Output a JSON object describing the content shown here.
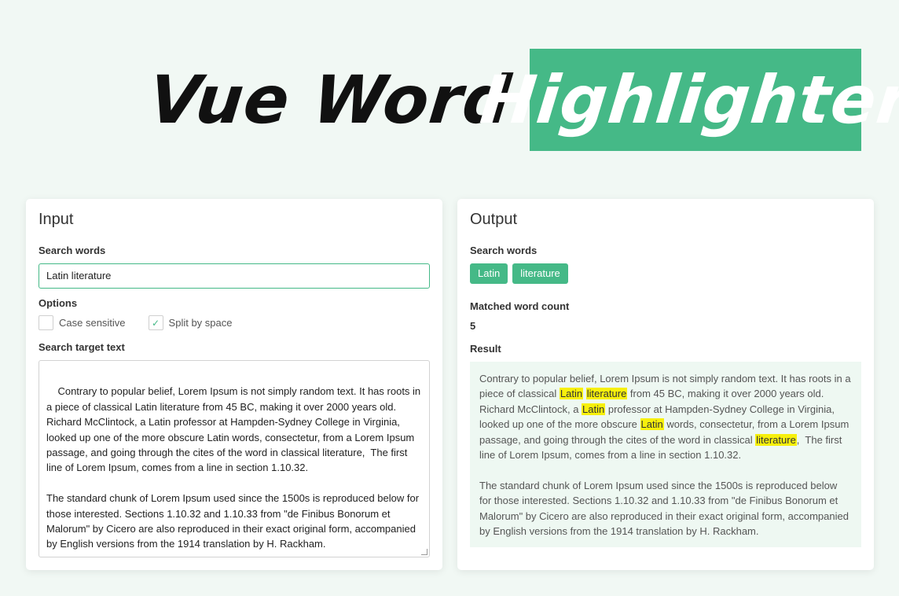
{
  "header": {
    "title_plain": "Vue Word",
    "title_highlight": "Highlighter"
  },
  "colors": {
    "accent": "#45b987",
    "highlight": "#f7f00c",
    "background": "#f1f8f4"
  },
  "input": {
    "title": "Input",
    "search_words_label": "Search words",
    "search_words_value": "Latin literature",
    "options_label": "Options",
    "options": [
      {
        "label": "Case sensitive",
        "checked": false
      },
      {
        "label": "Split by space",
        "checked": true
      }
    ],
    "target_text_label": "Search target text",
    "target_text": "Contrary to popular belief, Lorem Ipsum is not simply random text. It has roots in a piece of classical Latin literature from 45 BC, making it over 2000 years old. Richard McClintock, a Latin professor at Hampden-Sydney College in Virginia, looked up one of the more obscure Latin words, consectetur, from a Lorem Ipsum passage, and going through the cites of the word in classical literature,  The first line of Lorem Ipsum, comes from a line in section 1.10.32.\n\nThe standard chunk of Lorem Ipsum used since the 1500s is reproduced below for those interested. Sections 1.10.32 and 1.10.33 from \"de Finibus Bonorum et Malorum\" by Cicero are also reproduced in their exact original form, accompanied by English versions from the 1914 translation by H. Rackham."
  },
  "output": {
    "title": "Output",
    "search_words_label": "Search words",
    "tags": [
      "Latin",
      "literature"
    ],
    "matched_count_label": "Matched word count",
    "matched_count": "5",
    "result_label": "Result",
    "result_segments": [
      {
        "text": "Contrary to popular belief, Lorem Ipsum is not simply random text. It has roots in a piece of classical ",
        "hl": false
      },
      {
        "text": "Latin",
        "hl": true
      },
      {
        "text": " ",
        "hl": false
      },
      {
        "text": "literature",
        "hl": true
      },
      {
        "text": " from 45 BC, making it over 2000 years old. Richard McClintock, a ",
        "hl": false
      },
      {
        "text": "Latin",
        "hl": true
      },
      {
        "text": " professor at Hampden-Sydney College in Virginia, looked up one of the more obscure ",
        "hl": false
      },
      {
        "text": "Latin",
        "hl": true
      },
      {
        "text": " words, consectetur, from a Lorem Ipsum passage, and going through the cites of the word in classical ",
        "hl": false
      },
      {
        "text": "literature",
        "hl": true
      },
      {
        "text": ",  The first line of Lorem Ipsum, comes from a line in section 1.10.32.\n\nThe standard chunk of Lorem Ipsum used since the 1500s is reproduced below for those interested. Sections 1.10.32 and 1.10.33 from \"de Finibus Bonorum et Malorum\" by Cicero are also reproduced in their exact original form, accompanied by English versions from the 1914 translation by H. Rackham.",
        "hl": false
      }
    ]
  }
}
